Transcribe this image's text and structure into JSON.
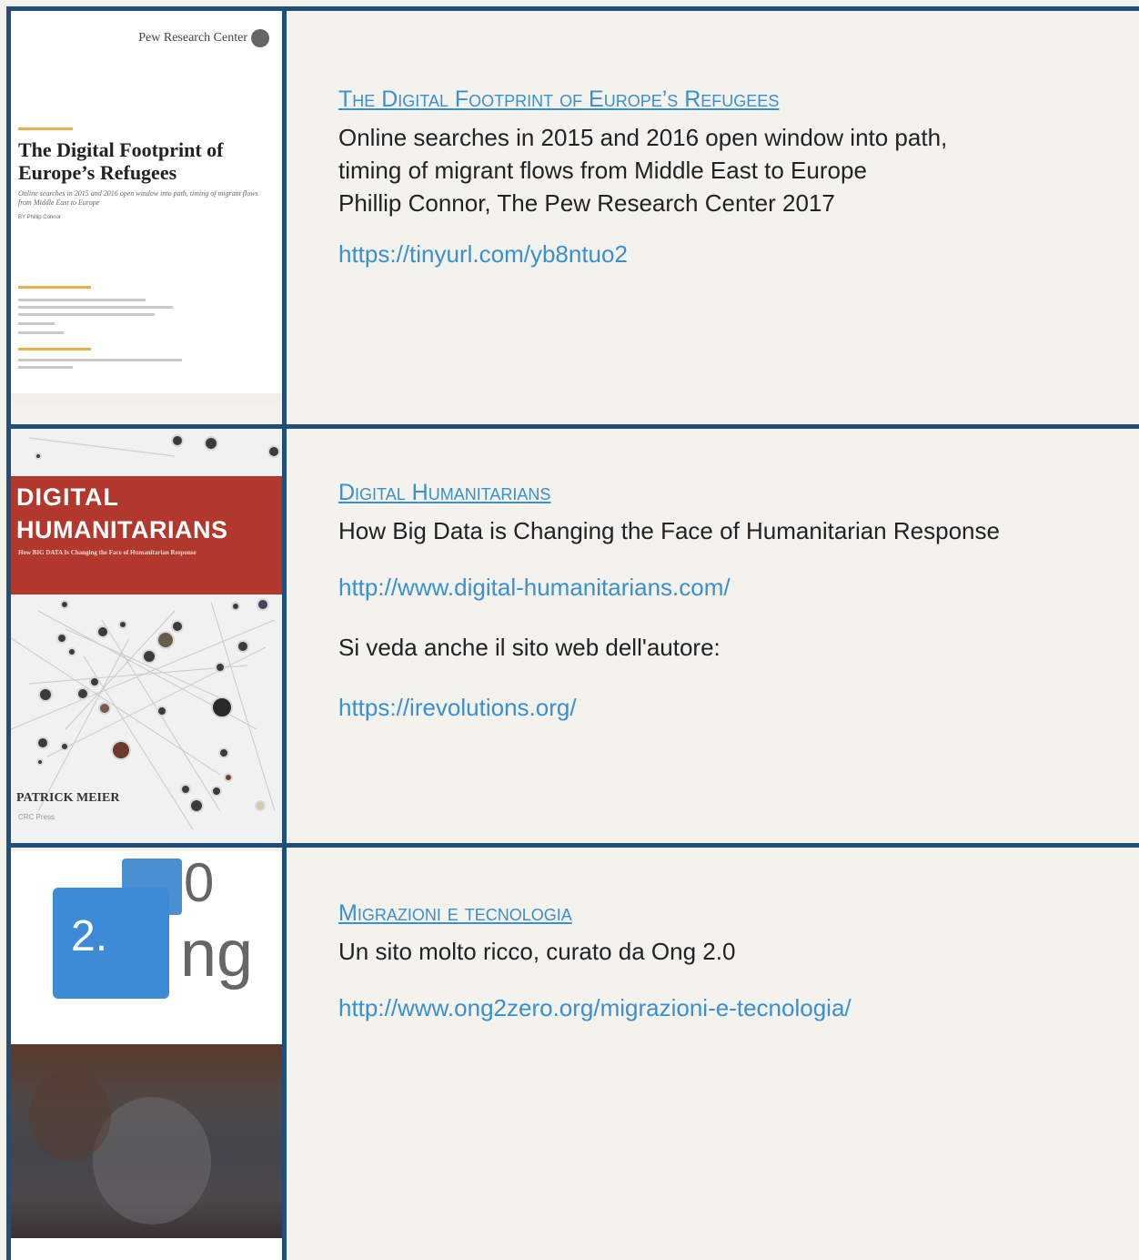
{
  "entries": [
    {
      "title": "The Digital Footprint of Europe’s Refugees",
      "description": [
        "Online searches in 2015 and 2016 open window into path,",
        "timing of migrant flows from Middle East to Europe",
        "Phillip Connor, The Pew Research Center 2017"
      ],
      "url": "https://tinyurl.com/yb8ntuo2",
      "cover": {
        "brand": "Pew Research Center",
        "title": "The Digital Footprint of Europe’s Refugees",
        "subtitle": "Online searches in 2015 and 2016 open window into path, timing of migrant flows from Middle East to Europe",
        "byline": "BY Phillip Connor"
      }
    },
    {
      "title": "Digital Humanitarians",
      "description": "How Big Data is Changing the Face of Humanitarian Response",
      "url": "http://www.digital-humanitarians.com/",
      "note": "Si veda anche il sito web dell'autore:",
      "url2": "https://irevolutions.org/",
      "cover": {
        "title_line1": "DIGITAL",
        "title_line2": "HUMANITARIANS",
        "subtitle": "How BIG DATA Is Changing the Face of Humanitarian Response",
        "author": "PATRICK MEIER",
        "publisher": "CRC Press"
      }
    },
    {
      "title": "Migrazioni e tecnologia",
      "description": "Un sito molto ricco, curato da Ong 2.0",
      "url": "http://www.ong2zero.org/migrazioni-e-tecnologia/",
      "cover": {
        "number": "2.",
        "zero": "0",
        "ng": "ng"
      }
    }
  ],
  "colors": {
    "border": "#1f4e79",
    "link": "#3a8fd0",
    "background": "#f3f2ec",
    "book_red": "#b2372d",
    "ong_blue": "#3d8bd6"
  }
}
